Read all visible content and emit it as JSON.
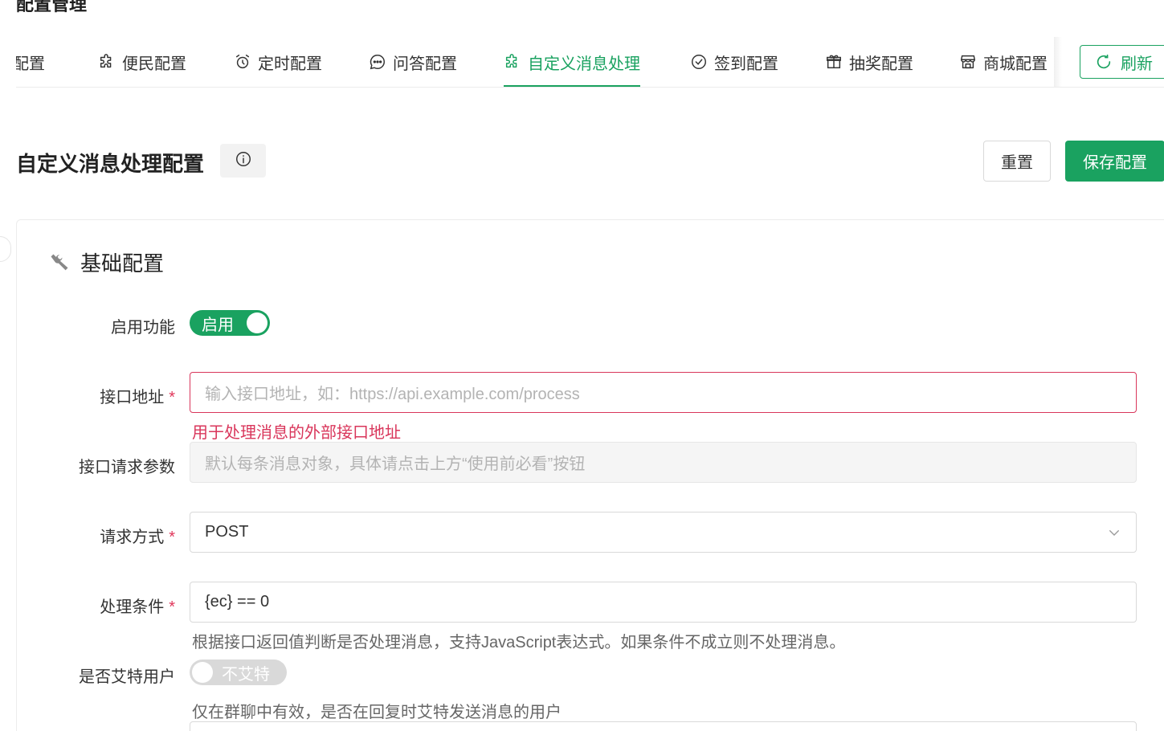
{
  "page": {
    "title": "配置管理"
  },
  "tabs": [
    {
      "label": "配置",
      "icon": "partial-tab-icon"
    },
    {
      "label": "便民配置",
      "icon": "puzzle-icon"
    },
    {
      "label": "定时配置",
      "icon": "alarm-clock-icon"
    },
    {
      "label": "问答配置",
      "icon": "chat-bubble-icon"
    },
    {
      "label": "自定义消息处理",
      "icon": "puzzle-icon",
      "active": true
    },
    {
      "label": "签到配置",
      "icon": "check-circle-icon"
    },
    {
      "label": "抽奖配置",
      "icon": "gift-icon"
    },
    {
      "label": "商城配置",
      "icon": "store-icon"
    }
  ],
  "refresh": {
    "label": "刷新",
    "icon": "refresh-icon"
  },
  "section": {
    "title": "自定义消息处理配置",
    "info_icon": "info-icon",
    "reset_label": "重置",
    "save_label": "保存配置"
  },
  "card": {
    "title": "基础配置",
    "icon": "wrench-icon"
  },
  "form": {
    "enable": {
      "label": "启用功能",
      "state": "启用",
      "on": true
    },
    "api_url": {
      "label": "接口地址",
      "required": "*",
      "placeholder": "输入接口地址，如：https://api.example.com/process",
      "error": "用于处理消息的外部接口地址"
    },
    "api_params": {
      "label": "接口请求参数",
      "placeholder": "默认每条消息对象，具体请点击上方“使用前必看”按钮"
    },
    "method": {
      "label": "请求方式",
      "required": "*",
      "value": "POST"
    },
    "condition": {
      "label": "处理条件",
      "required": "*",
      "value": "{ec} == 0",
      "help": "根据接口返回值判断是否处理消息，支持JavaScript表达式。如果条件不成立则不处理消息。"
    },
    "at_user": {
      "label": "是否艾特用户",
      "state": "不艾特",
      "on": false,
      "help": "仅在群聊中有效，是否在回复时艾特发送消息的用户"
    }
  },
  "colors": {
    "accent": "#1aa260",
    "error": "#d9365b"
  }
}
